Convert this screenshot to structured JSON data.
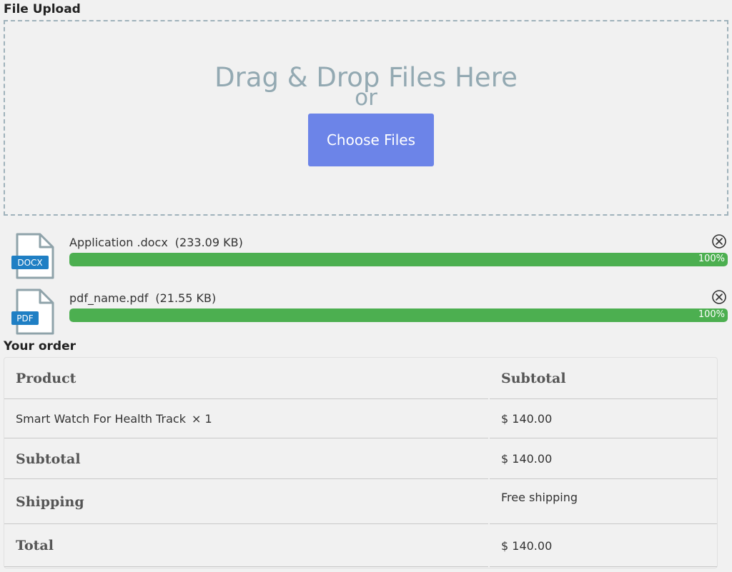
{
  "upload": {
    "title": "File Upload",
    "dropzone_title": "Drag & Drop Files Here",
    "dropzone_or": "or",
    "choose_label": "Choose Files"
  },
  "files": [
    {
      "type_label": "DOCX",
      "name": "Application .docx",
      "size": "(233.09 KB)",
      "progress_percent": 100,
      "progress_label": "100%"
    },
    {
      "type_label": "PDF",
      "name": "pdf_name.pdf",
      "size": "(21.55 KB)",
      "progress_percent": 100,
      "progress_label": "100%"
    }
  ],
  "order": {
    "title": "Your order",
    "header_product": "Product",
    "header_subtotal": "Subtotal",
    "item_name": "Smart Watch For Health Track",
    "item_qty": "× 1",
    "item_price": "$ 140.00",
    "subtotal_label": "Subtotal",
    "subtotal_value": "$ 140.00",
    "shipping_label": "Shipping",
    "shipping_value": "Free shipping",
    "total_label": "Total",
    "total_value": "$ 140.00"
  },
  "colors": {
    "accent_button": "#6c84e8",
    "progress_fill": "#4caf50",
    "file_badge": "#1f7fc4",
    "dropzone_text": "#93a9b2"
  },
  "icons": {
    "file": "document-icon",
    "remove": "close-circle-icon"
  }
}
